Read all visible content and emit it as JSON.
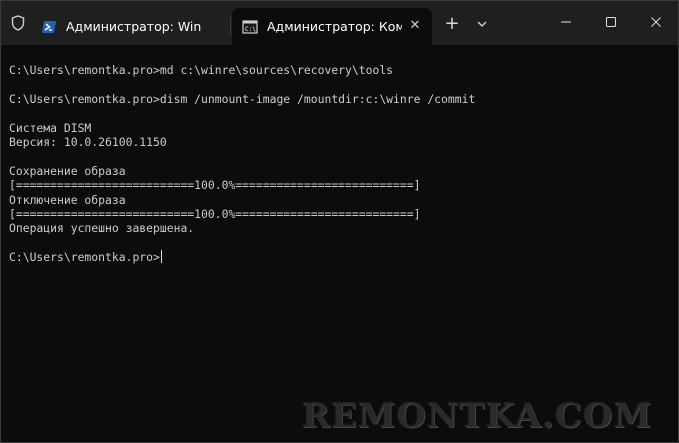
{
  "tabs": [
    {
      "title": "Администратор: Windows PowerShell",
      "icon": "powershell-icon",
      "active": false
    },
    {
      "title": "Администратор: Командная строка",
      "icon": "cmd-icon",
      "active": true
    }
  ],
  "terminal": {
    "lines": [
      "C:\\Users\\remontka.pro>md c:\\winre\\sources\\recovery\\tools",
      "",
      "C:\\Users\\remontka.pro>dism /unmount-image /mountdir:c:\\winre /commit",
      "",
      "Система DISM",
      "Версия: 10.0.26100.1150",
      "",
      "Сохранение образа",
      "[==========================100.0%==========================]",
      "Отключение образа",
      "[==========================100.0%==========================]",
      "Операция успешно завершена.",
      "",
      "C:\\Users\\remontka.pro>"
    ]
  },
  "watermark": "REMONTKA.COM",
  "colors": {
    "titlebar": "#1f1f1f",
    "terminal_bg": "#0c0c0c",
    "terminal_text": "#cccccc",
    "powershell_accent": "#2b5fb6"
  }
}
